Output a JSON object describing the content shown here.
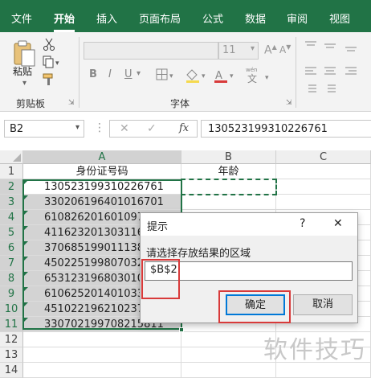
{
  "ribbon_tabs": [
    "文件",
    "开始",
    "插入",
    "页面布局",
    "公式",
    "数据",
    "审阅",
    "视图"
  ],
  "active_tab": "开始",
  "clipboard": {
    "paste_label": "粘贴",
    "group_label": "剪贴板"
  },
  "font": {
    "size": "11",
    "group_label": "字体",
    "bold": "B",
    "italic": "I",
    "underline": "U"
  },
  "name_box": "B2",
  "fx_label": "fx",
  "formula_value": "130523199310226761",
  "columns": [
    "A",
    "B",
    "C"
  ],
  "rows": [
    "1",
    "2",
    "3",
    "4",
    "5",
    "6",
    "7",
    "8",
    "9",
    "10",
    "11",
    "12",
    "13",
    "14"
  ],
  "header_row": {
    "a": "身份证号码",
    "b": "年龄"
  },
  "id_numbers": [
    "130523199310226761",
    "330206196401016701",
    "610826201601097",
    "411623201303116",
    "370685199011138",
    "450225199807032",
    "653123196803010",
    "610625201401033",
    "451022196210237",
    "330702199708215811"
  ],
  "dialog": {
    "title": "提示",
    "help": "?",
    "close": "✕",
    "prompt": "请选择存放结果的区域",
    "input_value": "$B$2",
    "ok_label": "确定",
    "cancel_label": "取消"
  },
  "watermark": "软件技巧",
  "colors": {
    "ribbon_green": "#217346",
    "highlight_red": "#d83a3a",
    "selection_border": "#217346"
  }
}
